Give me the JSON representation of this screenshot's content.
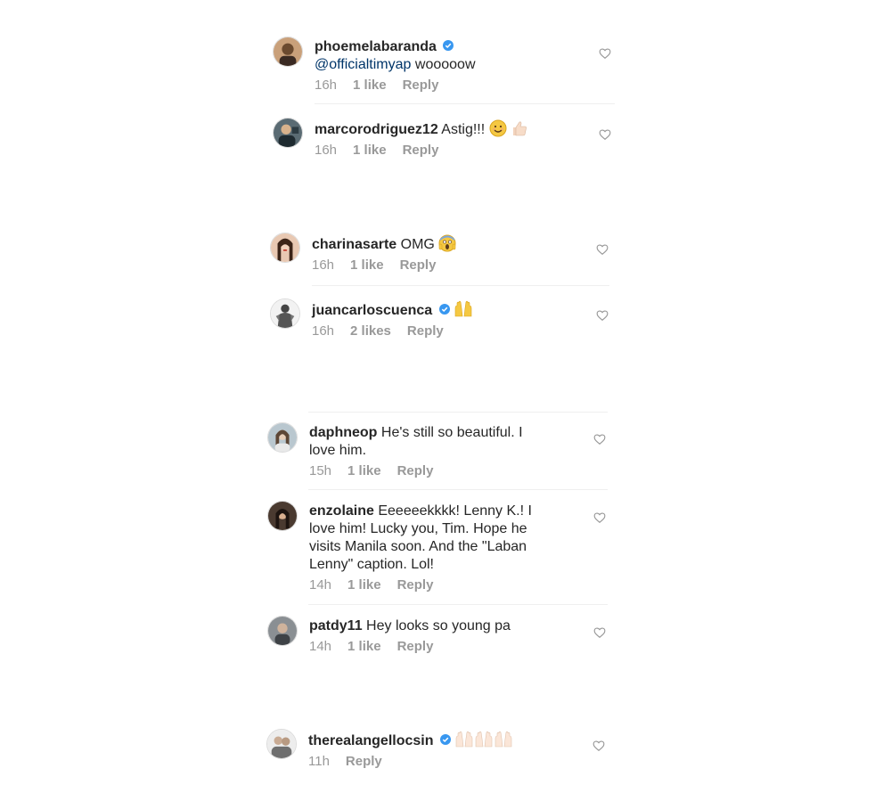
{
  "comments": [
    {
      "username": "phoemelabaranda",
      "verified": true,
      "mention": "@officialtimyap",
      "text": "wooooow",
      "time": "16h",
      "likes": "1 like",
      "reply": "Reply"
    },
    {
      "username": "marcorodriguez12",
      "verified": false,
      "text": "Astig!!!",
      "time": "16h",
      "likes": "1 like",
      "reply": "Reply"
    },
    {
      "username": "charinasarte",
      "verified": false,
      "text": "OMG",
      "time": "16h",
      "likes": "1 like",
      "reply": "Reply"
    },
    {
      "username": "juancarloscuenca",
      "verified": true,
      "text": "",
      "time": "16h",
      "likes": "2 likes",
      "reply": "Reply"
    },
    {
      "username": "daphneop",
      "verified": false,
      "text": "He's still so beautiful. I love him.",
      "time": "15h",
      "likes": "1 like",
      "reply": "Reply"
    },
    {
      "username": "enzolaine",
      "verified": false,
      "text": "Eeeeeekkkk! Lenny K.! I love him!  Lucky you, Tim.  Hope he visits Manila soon.  And the \"Laban Lenny\" caption.  Lol!",
      "time": "14h",
      "likes": "1 like",
      "reply": "Reply"
    },
    {
      "username": "patdy11",
      "verified": false,
      "text": "Hey looks so young pa",
      "time": "14h",
      "likes": "1 like",
      "reply": "Reply"
    },
    {
      "username": "therealangellocsin",
      "verified": true,
      "text": "",
      "time": "11h",
      "likes": "",
      "reply": "Reply"
    }
  ],
  "colors": {
    "text": "#262626",
    "meta": "#999999",
    "mention": "#003569",
    "verified": "#3897f0",
    "divider": "#efefef"
  },
  "icons": {
    "like": "heart-outline-icon",
    "verified": "verified-badge-icon",
    "emoji_smile": "smiling-face-emoji",
    "emoji_thumbs": "thumbs-up-emoji",
    "emoji_scream": "screaming-face-emoji",
    "emoji_hands": "raising-hands-emoji"
  }
}
